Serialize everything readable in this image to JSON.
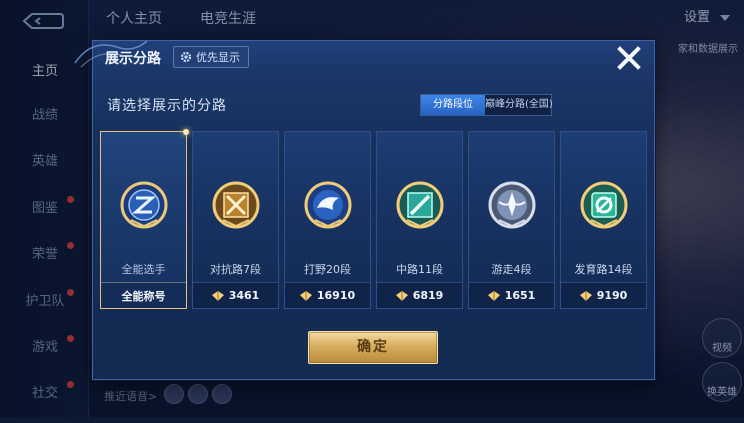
{
  "background": {
    "sidebar_items": [
      {
        "label": "主页",
        "active": true,
        "dot": false
      },
      {
        "label": "战绩",
        "active": false,
        "dot": false
      },
      {
        "label": "英雄",
        "active": false,
        "dot": false
      },
      {
        "label": "图鉴",
        "active": false,
        "dot": true
      },
      {
        "label": "荣誉",
        "active": false,
        "dot": true
      },
      {
        "label": "护卫队",
        "active": false,
        "dot": true
      },
      {
        "label": "游戏",
        "active": false,
        "dot": true
      },
      {
        "label": "社交",
        "active": false,
        "dot": true
      }
    ],
    "tabs": [
      "个人主页",
      "电竞生涯"
    ],
    "settings": "设置",
    "right_hint": "家和数据展示",
    "btn_a": "视频",
    "btn_b": "换英雄",
    "bottom_hint": "推近语音>"
  },
  "modal": {
    "title": "展示分路",
    "priority_label": "优先显示",
    "subtitle": "请选择展示的分路",
    "segment": {
      "options": [
        "分路段位",
        "巅峰分路(全国)"
      ],
      "selected": "分路段位"
    },
    "cards": [
      {
        "name": "全能选手",
        "footer": "全能称号",
        "selected": true,
        "emblem": "all-round-emblem-icon"
      },
      {
        "name": "对抗路7段",
        "footer": "3461",
        "selected": false,
        "emblem": "clash-lane-emblem-icon"
      },
      {
        "name": "打野20段",
        "footer": "16910",
        "selected": false,
        "emblem": "jungle-emblem-icon"
      },
      {
        "name": "中路11段",
        "footer": "6819",
        "selected": false,
        "emblem": "mid-lane-emblem-icon"
      },
      {
        "name": "游走4段",
        "footer": "1651",
        "selected": false,
        "emblem": "roam-emblem-icon"
      },
      {
        "name": "发育路14段",
        "footer": "9190",
        "selected": false,
        "emblem": "farm-lane-emblem-icon"
      }
    ],
    "confirm_label": "确定"
  },
  "colors": {
    "accent_blue": "#2f6fd0",
    "gold": "#e6c27a",
    "panel": "#17305c"
  }
}
